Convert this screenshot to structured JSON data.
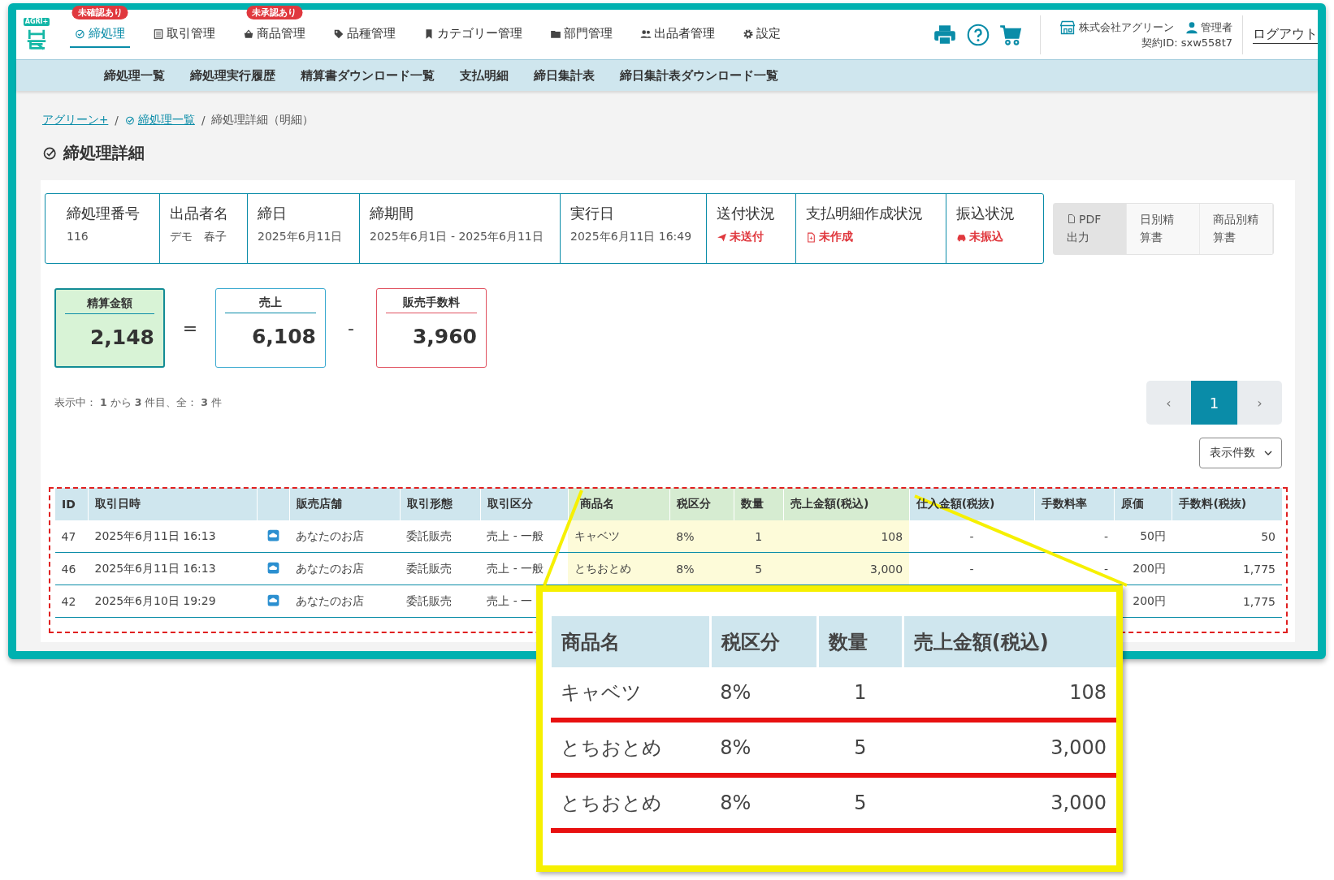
{
  "header": {
    "logo": "AGRI+",
    "nav": [
      {
        "label": "締処理",
        "selected": true,
        "badge": "未確認あり"
      },
      {
        "label": "取引管理",
        "selected": false
      },
      {
        "label": "商品管理",
        "selected": false,
        "badge": "未承認あり"
      },
      {
        "label": "品種管理",
        "selected": false
      },
      {
        "label": "カテゴリー管理",
        "selected": false
      },
      {
        "label": "部門管理",
        "selected": false
      },
      {
        "label": "出品者管理",
        "selected": false
      },
      {
        "label": "設定",
        "selected": false
      }
    ],
    "company": "株式会社アグリーン",
    "user": "管理者",
    "contract": "契約ID: sxw558t7",
    "logout": "ログアウト"
  },
  "subnav": [
    "締処理一覧",
    "締処理実行履歴",
    "精算書ダウンロード一覧",
    "支払明細",
    "締日集計表",
    "締日集計表ダウンロード一覧"
  ],
  "breadcrumb": [
    {
      "label": "アグリーン+",
      "link": true
    },
    {
      "label": "締処理一覧",
      "link": true,
      "separator": "/"
    },
    {
      "label": "締処理詳細（明細）",
      "link": false,
      "separator": "/"
    }
  ],
  "title": "締処理詳細",
  "info": [
    {
      "label": "締処理番号",
      "value": "116"
    },
    {
      "label": "出品者名",
      "value": "デモ　春子"
    },
    {
      "label": "締日",
      "value": "2025年6月11日"
    },
    {
      "label": "締期間",
      "value": "2025年6月1日 - 2025年6月11日"
    },
    {
      "label": "実行日",
      "value": "2025年6月11日 16:49"
    },
    {
      "label": "送付状況",
      "value": "未送付",
      "kind": "status"
    },
    {
      "label": "支払明細作成状況",
      "value": "未作成",
      "kind": "status"
    },
    {
      "label": "振込状況",
      "value": "未振込",
      "kind": "status"
    }
  ],
  "report_buttons": [
    {
      "lines": [
        "PDF",
        "出力"
      ],
      "selected": true
    },
    {
      "lines": [
        "日別精",
        "算書"
      ],
      "selected": false
    },
    {
      "lines": [
        "商品別精",
        "算書"
      ],
      "selected": false
    }
  ],
  "summary": {
    "items": [
      {
        "kind": "result",
        "label": "精算金額",
        "value": "2,148"
      },
      {
        "kind": "sales",
        "label": "売上",
        "value": "6,108"
      },
      {
        "kind": "fee",
        "label": "販売手数料",
        "value": "3,960"
      }
    ],
    "operators": [
      "=",
      "-"
    ]
  },
  "count_text": "表示中： **1** から **3** 件目、全： **3** 件",
  "pagination": {
    "prev": "‹",
    "next": "›",
    "pages": [
      {
        "label": "1",
        "selected": true
      }
    ]
  },
  "page_size": "表示件数",
  "table": {
    "columns": [
      {
        "label": "ID"
      },
      {
        "label": "取引日時"
      },
      {
        "kind": "icon"
      },
      {
        "label": "販売店舗"
      },
      {
        "label": "取引形態"
      },
      {
        "label": "取引区分"
      },
      {
        "label": "商品名",
        "highlight": true
      },
      {
        "label": "税区分",
        "highlight": true
      },
      {
        "label": "数量",
        "highlight": true
      },
      {
        "label": "売上金額(税込)",
        "highlight": true
      },
      {
        "label": "仕入金額(税抜)"
      },
      {
        "label": "手数料率"
      },
      {
        "label": "原価"
      },
      {
        "label": "手数料(税抜)"
      }
    ],
    "rows": [
      {
        "cells": [
          "47",
          "2025年6月11日 16:13",
          "",
          "あなたのお店",
          "委託販売",
          "売上 - 一般",
          "キャベツ",
          "8%",
          "1",
          "108",
          "-",
          "-",
          "50円",
          "50"
        ]
      },
      {
        "cells": [
          "46",
          "2025年6月11日 16:13",
          "",
          "あなたのお店",
          "委託販売",
          "売上 - 一般",
          "とちおとめ",
          "8%",
          "5",
          "3,000",
          "-",
          "-",
          "200円",
          "1,775"
        ]
      },
      {
        "cells": [
          "42",
          "2025年6月10日 19:29",
          "",
          "あなたのお店",
          "委託販売",
          "売上 - 一",
          null,
          null,
          null,
          null,
          null,
          null,
          "200円",
          "1,775"
        ]
      }
    ]
  },
  "callout": {
    "columns": [
      "商品名",
      "税区分",
      "数量",
      "売上金額(税込)"
    ],
    "rows": [
      [
        "キャベツ",
        "8%",
        "1",
        "108"
      ],
      [
        "とちおとめ",
        "8%",
        "5",
        "3,000"
      ],
      [
        "とちおとめ",
        "8%",
        "5",
        "3,000"
      ]
    ]
  }
}
